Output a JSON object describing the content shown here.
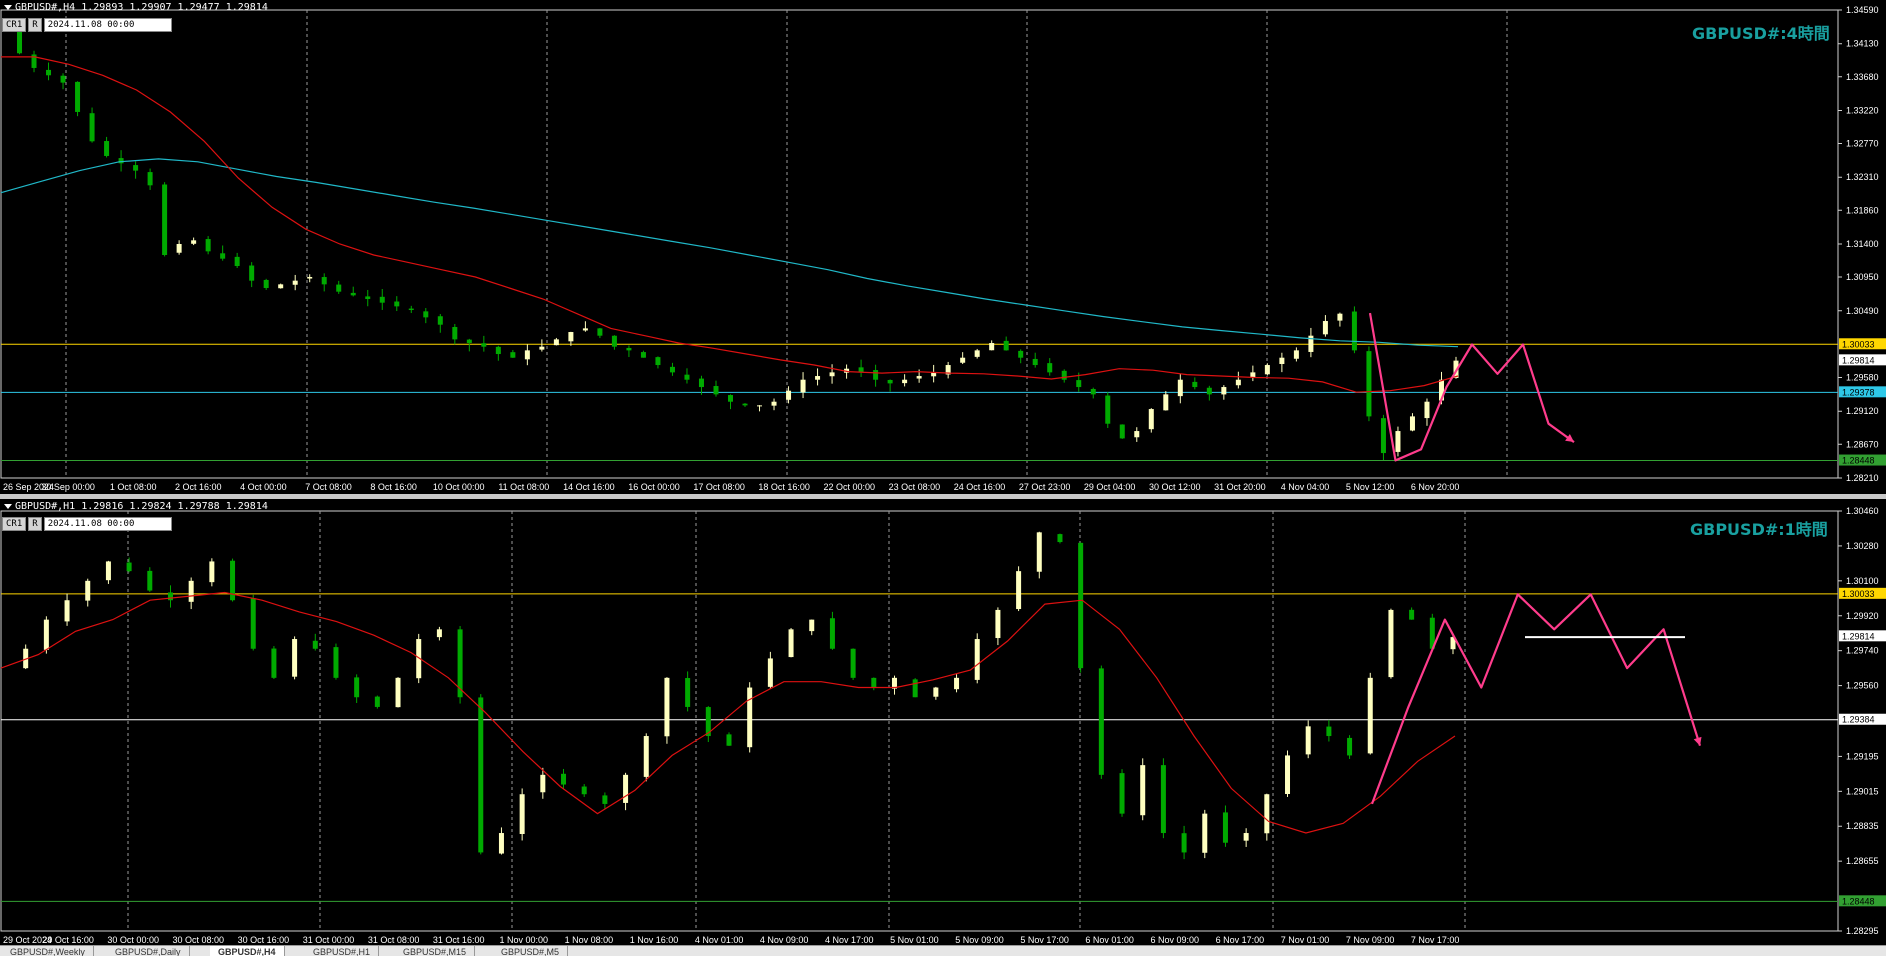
{
  "charts": {
    "h4": {
      "header": "GBPUSD#,H4  1.29893 1.29907 1.29477 1.29814",
      "mini_cr": "CR1",
      "mini_r": "R",
      "mini_date": "2024.11.08 00:00",
      "title": "GBPUSD#:4時間"
    },
    "h1": {
      "header": "GBPUSD#,H1  1.29816 1.29824 1.29788 1.29814",
      "mini_cr": "CR1",
      "mini_r": "R",
      "mini_date": "2024.11.08 00:00",
      "title": "GBPUSD#:1時間"
    }
  },
  "tabs": [
    "GBPUSD#,Weekly",
    "GBPUSD#,Daily",
    "GBPUSD#,H4",
    "GBPUSD#,H1",
    "GBPUSD#,M15",
    "GBPUSD#,M5"
  ],
  "active_tab": 2,
  "colors": {
    "bull": "#ffffc0",
    "bear": "#00aa00",
    "ma_fast": "#dd1111",
    "ma_slow": "#20b8c8",
    "level_upper": "#ffd700",
    "level_lower": "#2ec8e8",
    "level_support": "#32a032",
    "forecast": "#ff3c8c",
    "axis_text": "#ffffff",
    "title": "#19a0a0"
  },
  "chart_data": [
    {
      "type": "candlestick",
      "timeframe": "H4",
      "ylim": [
        1.2821,
        1.3459
      ],
      "y_ticks": [
        "1.34590",
        "1.34130",
        "1.33680",
        "1.33220",
        "1.32770",
        "1.32310",
        "1.31860",
        "1.31400",
        "1.30950",
        "1.30490",
        "1.30033",
        "1.29814",
        "1.29580",
        "1.29378",
        "1.29120",
        "1.28670",
        "1.28448",
        "1.28210"
      ],
      "x_labels": [
        "26 Sep 2024",
        "30 Sep 00:00",
        "1 Oct 08:00",
        "2 Oct 16:00",
        "4 Oct 00:00",
        "7 Oct 08:00",
        "8 Oct 16:00",
        "10 Oct 00:00",
        "11 Oct 08:00",
        "14 Oct 16:00",
        "16 Oct 00:00",
        "17 Oct 08:00",
        "18 Oct 16:00",
        "22 Oct 00:00",
        "23 Oct 08:00",
        "24 Oct 16:00",
        "27 Oct 23:00",
        "29 Oct 04:00",
        "30 Oct 12:00",
        "31 Oct 20:00",
        "4 Nov 04:00",
        "5 Nov 12:00",
        "6 Nov 20:00"
      ],
      "levels": [
        {
          "value": 1.30033,
          "label": "1.30033",
          "color": "#ffd700"
        },
        {
          "value": 1.29378,
          "label": "1.29378",
          "color": "#2ec8e8"
        },
        {
          "value": 1.28448,
          "label": "1.28448",
          "color": "#32a032"
        }
      ],
      "current_price": {
        "value": 1.29814,
        "label": "1.29814"
      },
      "close_path": [
        1.343,
        1.34,
        1.338,
        1.337,
        1.336,
        1.332,
        1.328,
        1.326,
        1.325,
        1.324,
        1.322,
        1.3125,
        1.314,
        1.3145,
        1.313,
        1.312,
        1.311,
        1.309,
        1.308,
        1.3085,
        1.309,
        1.3095,
        1.3085,
        1.3075,
        1.307,
        1.3065,
        1.306,
        1.3055,
        1.305,
        1.304,
        1.303,
        1.301,
        1.3005,
        1.3,
        1.299,
        1.2985,
        1.2995,
        1.3,
        1.301,
        1.302,
        1.3025,
        1.3015,
        1.3,
        1.2995,
        1.2985,
        1.2975,
        1.2965,
        1.2955,
        1.2945,
        1.2935,
        1.2925,
        1.292,
        1.292,
        1.2925,
        1.294,
        1.2955,
        1.296,
        1.2965,
        1.297,
        1.2965,
        1.2955,
        1.295,
        1.2955,
        1.296,
        1.2965,
        1.2975,
        1.2985,
        1.2995,
        1.3005,
        1.2995,
        1.2985,
        1.2975,
        1.2965,
        1.2955,
        1.2945,
        1.2935,
        1.2895,
        1.2875,
        1.2885,
        1.2915,
        1.2935,
        1.2955,
        1.2945,
        1.2935,
        1.2945,
        1.2955,
        1.2965,
        1.2975,
        1.2985,
        1.2995,
        1.3015,
        1.3035,
        1.3045,
        1.2995,
        1.2905,
        1.2855,
        1.2885,
        1.2905,
        1.2925,
        1.2955,
        1.2981
      ],
      "ma_fast": [
        1.3395,
        1.3395,
        1.3385,
        1.337,
        1.335,
        1.332,
        1.328,
        1.323,
        1.319,
        1.316,
        1.314,
        1.3125,
        1.3115,
        1.3105,
        1.3095,
        1.308,
        1.3065,
        1.3045,
        1.3025,
        1.3015,
        1.3005,
        1.2998,
        1.299,
        1.2982,
        1.2975,
        1.2966,
        1.2964,
        1.2966,
        1.2964,
        1.2963,
        1.296,
        1.2956,
        1.2962,
        1.297,
        1.2968,
        1.2962,
        1.296,
        1.2958,
        1.2957,
        1.2952,
        1.2938,
        1.294,
        1.2947,
        1.296
      ],
      "ma_slow": [
        1.321,
        1.3225,
        1.324,
        1.3252,
        1.3256,
        1.3252,
        1.3242,
        1.3232,
        1.3224,
        1.3215,
        1.3206,
        1.3197,
        1.3189,
        1.318,
        1.3171,
        1.3162,
        1.3153,
        1.3144,
        1.3135,
        1.3125,
        1.3115,
        1.3105,
        1.3093,
        1.3083,
        1.3074,
        1.3065,
        1.3057,
        1.3049,
        1.3041,
        1.3034,
        1.3027,
        1.3022,
        1.3017,
        1.3012,
        1.3008,
        1.3006,
        1.3002,
        1.3
      ],
      "forecast_path": [
        1.3046,
        1.2845,
        1.286,
        1.2945,
        1.3003,
        1.2963,
        1.3003,
        1.2895,
        1.287
      ]
    },
    {
      "type": "candlestick",
      "timeframe": "H1",
      "ylim": [
        1.28295,
        1.3046
      ],
      "y_ticks": [
        "1.30460",
        "1.30280",
        "1.30100",
        "1.30033",
        "1.29920",
        "1.29814",
        "1.29740",
        "1.29560",
        "1.29384",
        "1.29195",
        "1.29015",
        "1.28835",
        "1.28655",
        "1.28448",
        "1.28295"
      ],
      "x_labels": [
        "29 Oct 2024",
        "29 Oct 16:00",
        "30 Oct 00:00",
        "30 Oct 08:00",
        "30 Oct 16:00",
        "31 Oct 00:00",
        "31 Oct 08:00",
        "31 Oct 16:00",
        "1 Nov 00:00",
        "1 Nov 08:00",
        "1 Nov 16:00",
        "4 Nov 01:00",
        "4 Nov 09:00",
        "4 Nov 17:00",
        "5 Nov 01:00",
        "5 Nov 09:00",
        "5 Nov 17:00",
        "6 Nov 01:00",
        "6 Nov 09:00",
        "6 Nov 17:00",
        "7 Nov 01:00",
        "7 Nov 09:00",
        "7 Nov 17:00"
      ],
      "levels": [
        {
          "value": 1.30033,
          "label": "1.30033",
          "color": "#ffd700"
        },
        {
          "value": 1.29384,
          "label": "1.29384",
          "color": "#ffffff"
        },
        {
          "value": 1.28448,
          "label": "1.28448",
          "color": "#32a032"
        }
      ],
      "current_price": {
        "value": 1.29814,
        "label": "1.29814"
      },
      "close_path": [
        1.2965,
        1.2975,
        1.299,
        1.3,
        1.301,
        1.302,
        1.3015,
        1.3005,
        1.3,
        1.301,
        1.302,
        1.3,
        1.2975,
        1.296,
        1.298,
        1.2975,
        1.296,
        1.295,
        1.2945,
        1.296,
        1.298,
        1.2985,
        1.295,
        1.287,
        1.288,
        1.29,
        1.291,
        1.2905,
        1.29,
        1.2895,
        1.291,
        1.293,
        1.296,
        1.2945,
        1.293,
        1.2925,
        1.2955,
        1.297,
        1.2985,
        1.299,
        1.2975,
        1.296,
        1.2955,
        1.296,
        1.295,
        1.2955,
        1.296,
        1.298,
        1.2995,
        1.3015,
        1.3035,
        1.303,
        1.2965,
        1.291,
        1.289,
        1.2915,
        1.288,
        1.287,
        1.289,
        1.2875,
        1.288,
        1.29,
        1.292,
        1.2935,
        1.293,
        1.292,
        1.296,
        1.2995,
        1.299,
        1.2975,
        1.2981
      ],
      "ma_fast": [
        1.2965,
        1.2972,
        1.2984,
        1.299,
        1.3,
        1.3002,
        1.3004,
        1.3,
        1.2994,
        1.2989,
        1.2982,
        1.2973,
        1.296,
        1.2942,
        1.2922,
        1.2904,
        1.289,
        1.2902,
        1.292,
        1.2932,
        1.2948,
        1.2958,
        1.2958,
        1.2955,
        1.2955,
        1.2959,
        1.2964,
        1.2979,
        1.2998,
        1.3,
        1.2985,
        1.296,
        1.293,
        1.2903,
        1.2886,
        1.288,
        1.2885,
        1.2899,
        1.2917,
        1.293
      ],
      "forecast_path": [
        1.2895,
        1.2945,
        1.299,
        1.2955,
        1.3003,
        1.2985,
        1.3003,
        1.2965,
        1.2985,
        1.2925
      ],
      "forecast_ref_line": 1.2981
    }
  ]
}
